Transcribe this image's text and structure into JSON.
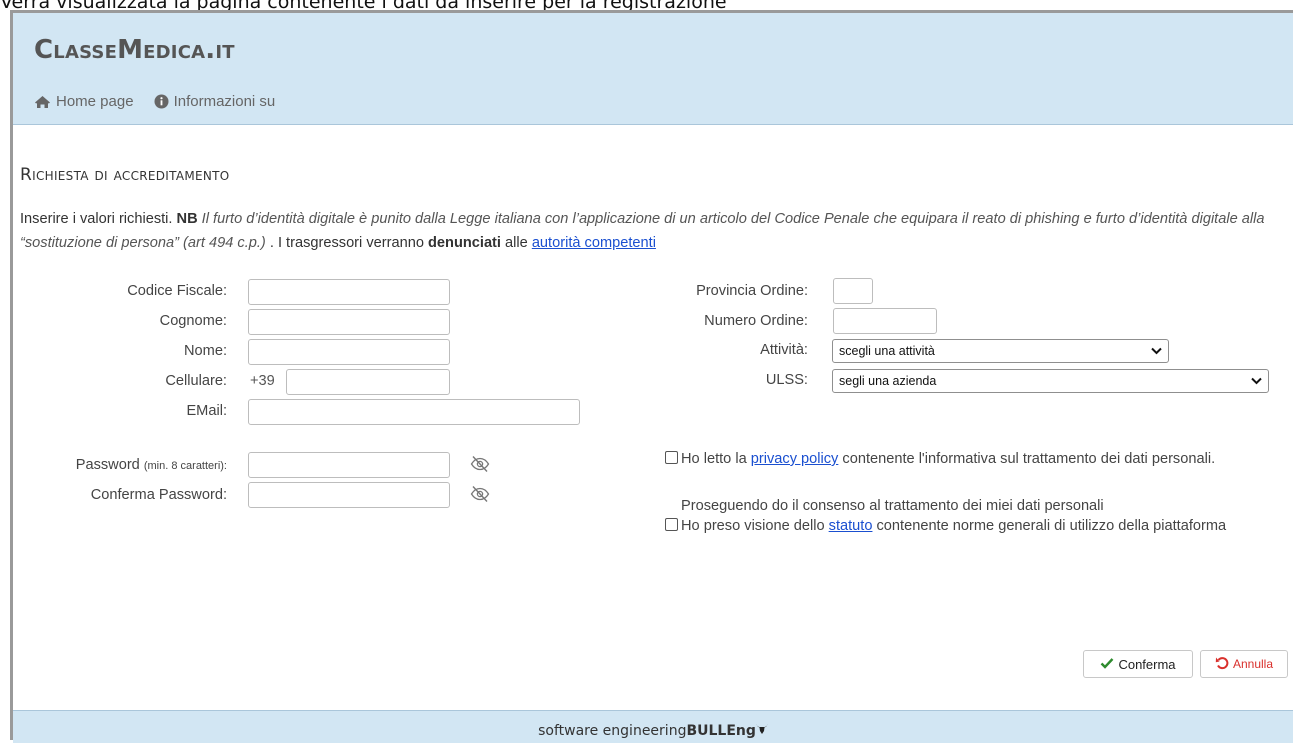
{
  "caption": "Verrà visualizzata la pagina contenente i dati da inserire per la registrazione",
  "header": {
    "brand": "ClasseMedica.it",
    "nav": [
      {
        "label": "Home page",
        "icon": "home-icon"
      },
      {
        "label": "Informazioni su",
        "icon": "info-icon"
      }
    ]
  },
  "section_title": "Richiesta di accreditamento",
  "intro": {
    "lead": "Inserire i valori richiesti. ",
    "nb": "NB",
    "italic": " Il furto d’identità digitale è punito dalla Legge italiana con l’applicazione di un articolo del Codice Penale che equipara il reato di phishing e furto d’identità digitale alla “sostituzione di persona” (art 494 c.p.)",
    "mid": " . I trasgressori verranno ",
    "bold": "denunciati",
    "after": " alle ",
    "link": "autorità competenti"
  },
  "form": {
    "codice_fiscale": "Codice Fiscale:",
    "cognome": "Cognome:",
    "nome": "Nome:",
    "cellulare": "Cellulare:",
    "cell_prefix": "+39",
    "email": "EMail:",
    "password": "Password ",
    "password_note": "(min. 8 caratteri):",
    "conferma_password": "Conferma Password:",
    "provincia_ordine": "Provincia Ordine:",
    "numero_ordine": "Numero Ordine:",
    "attivita": "Attività:",
    "attivita_value": "scegli una attività",
    "ulss": "ULSS:",
    "ulss_value": "segli una azienda"
  },
  "consent": {
    "privacy_pre": "Ho letto la ",
    "privacy_link": "privacy policy",
    "privacy_post": " contenente l'informativa sul trattamento dei dati personali.",
    "note": "Proseguendo do il consenso al trattamento dei miei dati personali",
    "statuto_pre": "Ho preso visione dello ",
    "statuto_link": "statuto",
    "statuto_post": " contenente norme generali di utilizzo della piattaforma"
  },
  "buttons": {
    "confirm": "Conferma",
    "cancel": "Annulla"
  },
  "footer": {
    "text": "software engineering ",
    "brand": "BULLEng"
  },
  "colors": {
    "header_bg": "#d2e6f3",
    "link": "#1a4fd0",
    "confirm_icon": "#2e8b2e",
    "cancel": "#d9302c"
  }
}
